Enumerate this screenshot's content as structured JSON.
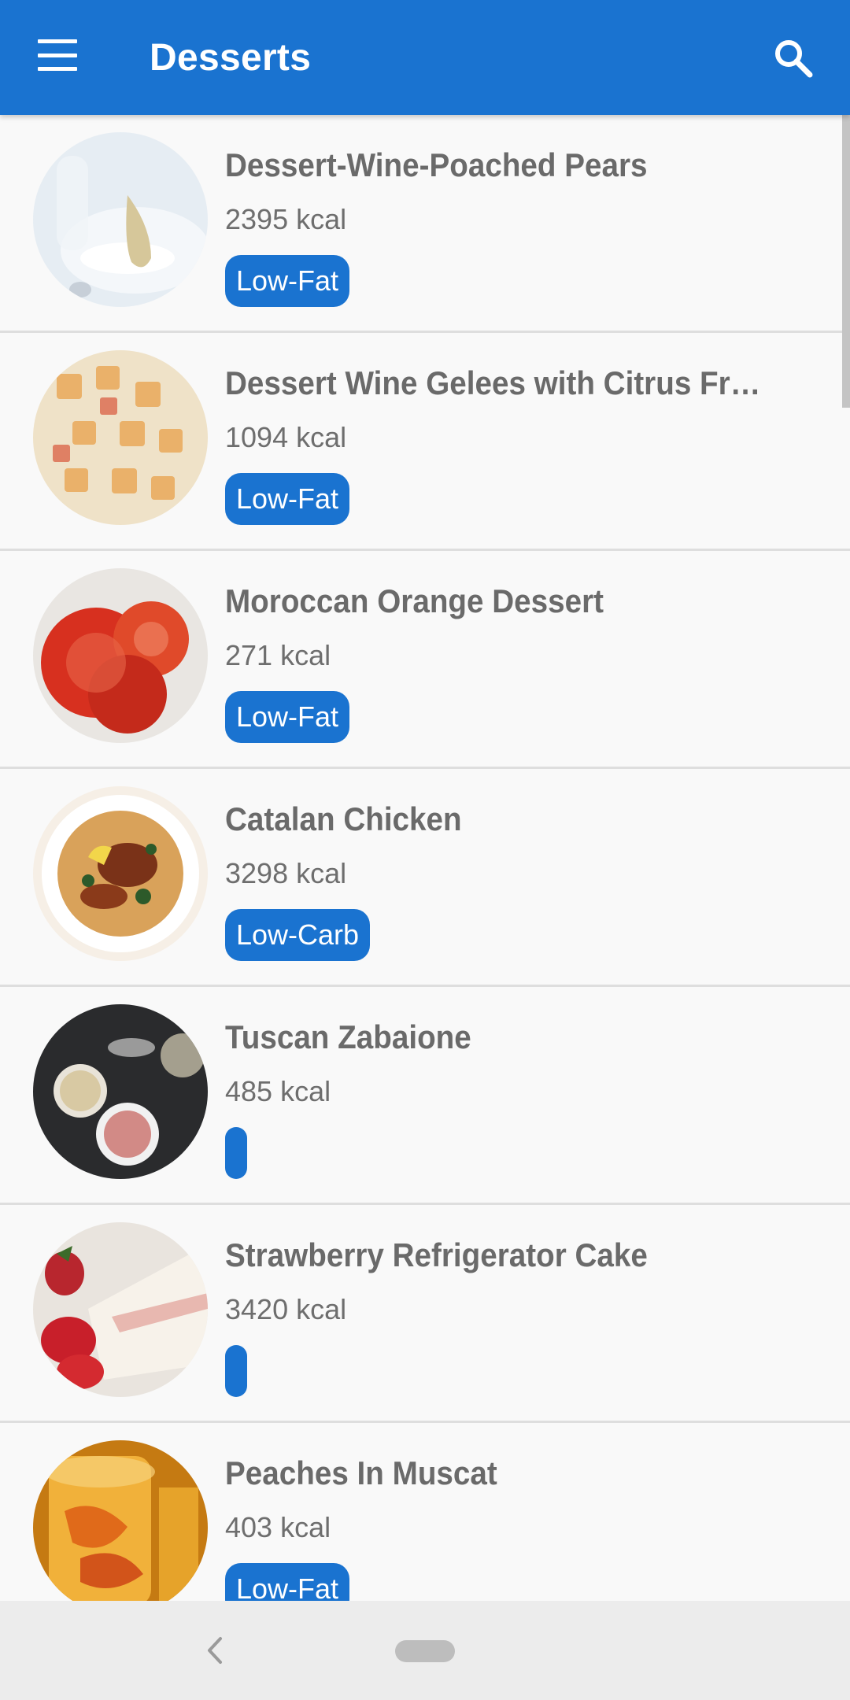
{
  "app": {
    "title": "Desserts"
  },
  "icons": {
    "menu": "menu-icon",
    "search": "search-icon",
    "back": "back-icon"
  },
  "colors": {
    "primary": "#1a73d0",
    "badge": "#1a73d0"
  },
  "recipes": [
    {
      "name": "Dessert-Wine-Poached Pears",
      "kcal": "2395 kcal",
      "tag": "Low-Fat"
    },
    {
      "name": "Dessert Wine Gelees with Citrus Fruit and Mint",
      "kcal": "1094 kcal",
      "tag": "Low-Fat"
    },
    {
      "name": "Moroccan Orange Dessert",
      "kcal": "271 kcal",
      "tag": "Low-Fat"
    },
    {
      "name": "Catalan Chicken",
      "kcal": "3298 kcal",
      "tag": "Low-Carb"
    },
    {
      "name": "Tuscan Zabaione",
      "kcal": "485 kcal",
      "tag": ""
    },
    {
      "name": "Strawberry Refrigerator Cake",
      "kcal": "3420 kcal",
      "tag": ""
    },
    {
      "name": "Peaches In Muscat",
      "kcal": "403 kcal",
      "tag": "Low-Fat"
    }
  ]
}
